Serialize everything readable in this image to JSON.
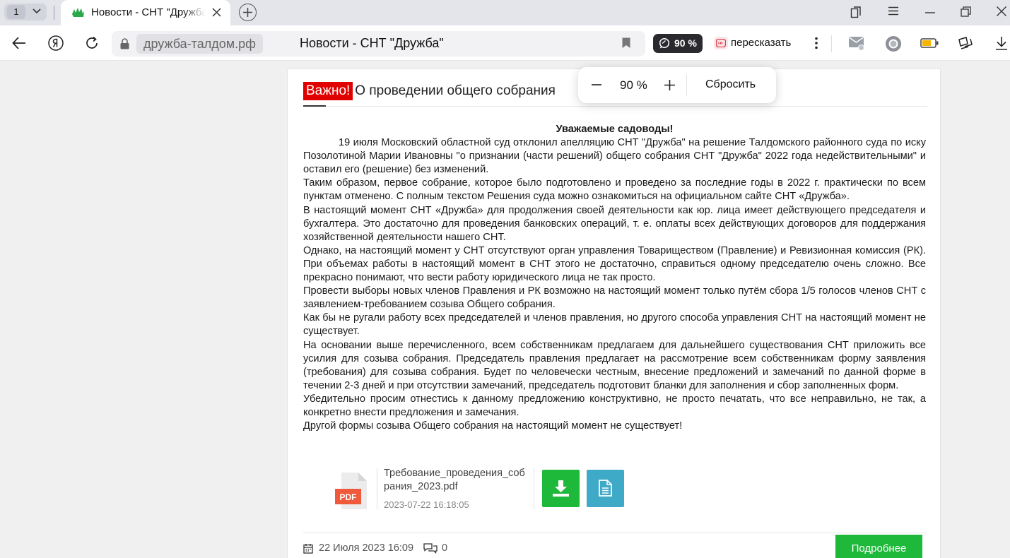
{
  "browser": {
    "tab_count": "1",
    "tab": {
      "title": "Новости - СНТ \"Дружба\""
    },
    "address": {
      "domain": "дружба-талдом.рф",
      "page_title": "Новости - СНТ \"Дружба\""
    },
    "zoom_badge": "90 %",
    "retell_label": "пересказать",
    "icons": [
      "back-icon",
      "yandex-icon",
      "reload-icon",
      "lock-icon",
      "bookmark-icon",
      "comment-icon",
      "kebab-icon",
      "mail-icon",
      "alice-icon",
      "battery-icon",
      "collections-icon",
      "download-icon"
    ]
  },
  "zoom_popup": {
    "minus": "−",
    "value": "90 %",
    "plus": "+",
    "reset_label": "Сбросить"
  },
  "article": {
    "badge": "Важно!",
    "title": "О проведении общего собрания",
    "greeting": "Уважаемые садоводы!",
    "paragraphs": [
      "19 июля Московский областной суд отклонил апелляцию СНТ \"Дружба\" на решение Талдомского районного суда по иску Позолотиной Марии Ивановны \"о признании (части решений) общего собрания СНТ \"Дружба\" 2022 года недействительными\" и оставил его (решение) без изменений.",
      "Таким образом, первое собрание, которое было подготовлено и проведено за последние годы в 2022 г.  практически по всем пунктам отменено. С полным текстом Решения суда можно ознакомиться на официальном сайте СНТ «Дружба».",
      "В настоящий момент СНТ «Дружба» для продолжения своей деятельности как юр. лица имеет действующего председателя и бухгалтера. Это достаточно для проведения банковских операций, т. е. оплаты всех действующих договоров для поддержания хозяйственной деятельности нашего СНТ.",
      "Однако, на настоящий момент у СНТ отсутствуют орган управления Товариществом (Правление) и Ревизионная комиссия (РК). При объемах работы в настоящий момент в СНТ этого не достаточно, справиться одному председателю очень сложно. Все прекрасно понимают, что вести работу юридического лица не так просто.",
      "Провести выборы новых членов Правления и РК возможно на настоящий момент только путём  сбора 1/5  голосов членов СНТ с заявлением-требованием созыва Общего собрания.",
      "Как бы не ругали работу всех председателей и членов правления, но другого способа управления СНТ на настоящий момент не существует.",
      "На основании выше перечисленного, всем собственникам предлагаем для дальнейшего существования СНТ приложить все усилия для созыва собрания.  Председатель правления предлагает  на рассмотрение всем собственникам форму заявления (требования) для созыва собрания.  Будет по человечески честным, внесение предложений и замечаний по данной форме в течении 2-3 дней и при отсутствии замечаний, председатель подготовит  бланки для  заполнения и сбор заполненных форм.",
      "Убедительно просим отнестись к данному предложению конструктивно, не просто печатать, что все неправильно, не так, а конкретно внести предложения и замечания.",
      "Другой формы созыва Общего собрания на настоящий момент не существует!"
    ],
    "attachment": {
      "filename": "Требование_проведения_собрания_2023.pdf",
      "datetime": "2023-07-22 16:18:05",
      "type_label": "PDF"
    },
    "footer": {
      "date": "22 Июля 2023 16:09",
      "comments": "0",
      "more_label": "Подробнее"
    }
  },
  "colors": {
    "badge_red": "#e00000",
    "green": "#1eb83b",
    "teal": "#3fa9c8"
  }
}
